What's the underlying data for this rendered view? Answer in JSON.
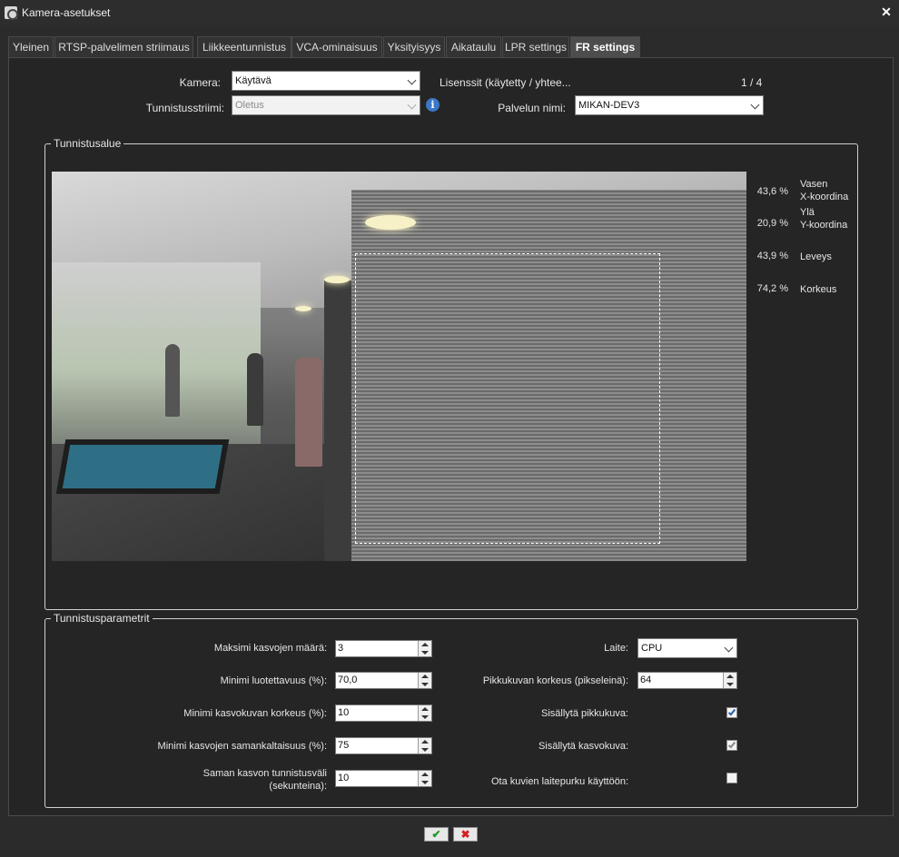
{
  "window": {
    "title": "Kamera-asetukset"
  },
  "tabs": [
    {
      "label": "Yleinen"
    },
    {
      "label": "RTSP-palvelimen striimaus"
    },
    {
      "label": "Liikkeentunnistus"
    },
    {
      "label": "VCA-ominaisuus"
    },
    {
      "label": "Yksityisyys"
    },
    {
      "label": "Aikataulu"
    },
    {
      "label": "LPR settings"
    },
    {
      "label": "FR settings",
      "active": true
    }
  ],
  "top": {
    "camera_label": "Kamera:",
    "camera_value": "Käytävä",
    "stream_label": "Tunnistusstriimi:",
    "stream_value": "Oletus",
    "licenses_label": "Lisenssit (käytetty / yhtee...",
    "licenses_value": "1 / 4",
    "service_label": "Palvelun nimi:",
    "service_value": "MIKAN-DEV3"
  },
  "area": {
    "legend": "Tunnistusalue",
    "left_x": {
      "value": "43,6 %",
      "label_line1": "Vasen",
      "label_line2": "X-koordina"
    },
    "top_y": {
      "value": "20,9 %",
      "label_line1": "Ylä",
      "label_line2": "Y-koordina"
    },
    "width": {
      "value": "43,9 %",
      "label": "Leveys"
    },
    "height": {
      "value": "74,2 %",
      "label": "Korkeus"
    }
  },
  "params": {
    "legend": "Tunnistusparametrit",
    "max_faces_label": "Maksimi kasvojen määrä:",
    "max_faces_value": "3",
    "min_confidence_label": "Minimi luotettavuus (%):",
    "min_confidence_value": "70,0",
    "min_face_height_label": "Minimi kasvokuvan korkeus (%):",
    "min_face_height_value": "10",
    "min_similarity_label": "Minimi kasvojen samankaltaisuus (%):",
    "min_similarity_value": "75",
    "interval_label_line1": "Saman kasvon tunnistusväli",
    "interval_label_line2": "(sekunteina):",
    "interval_value": "10",
    "device_label": "Laite:",
    "device_value": "CPU",
    "thumb_height_label": "Pikkukuvan korkeus (pikseleinä):",
    "thumb_height_value": "64",
    "include_thumb_label": "Sisällytä pikkukuva:",
    "include_thumb_checked": true,
    "include_face_label": "Sisällytä kasvokuva:",
    "include_face_checked": true,
    "hw_decode_label": "Ota kuvien laitepurku käyttöön:",
    "hw_decode_checked": false
  },
  "footer": {
    "ok_glyph": "✔",
    "cancel_glyph": "✖"
  },
  "icons": {
    "title": "camera-settings-icon",
    "close": "close-icon",
    "info": "info-icon"
  }
}
